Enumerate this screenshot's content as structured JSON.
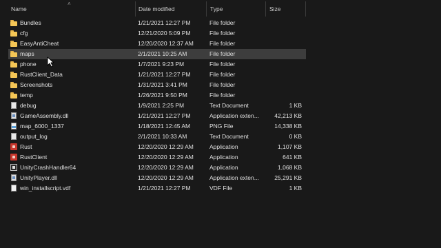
{
  "columns": {
    "name": "Name",
    "date": "Date modified",
    "type": "Type",
    "size": "Size"
  },
  "files": [
    {
      "name": "Bundles",
      "date": "1/21/2021 12:27 PM",
      "type": "File folder",
      "size": "",
      "icon": "folder-icon"
    },
    {
      "name": "cfg",
      "date": "12/21/2020 5:09 PM",
      "type": "File folder",
      "size": "",
      "icon": "folder-icon"
    },
    {
      "name": "EasyAntiCheat",
      "date": "12/20/2020 12:37 AM",
      "type": "File folder",
      "size": "",
      "icon": "folder-icon"
    },
    {
      "name": "maps",
      "date": "2/1/2021 10:25 AM",
      "type": "File folder",
      "size": "",
      "icon": "folder-icon",
      "selected": true
    },
    {
      "name": "phone",
      "date": "1/7/2021 9:23 PM",
      "type": "File folder",
      "size": "",
      "icon": "folder-icon"
    },
    {
      "name": "RustClient_Data",
      "date": "1/21/2021 12:27 PM",
      "type": "File folder",
      "size": "",
      "icon": "folder-icon"
    },
    {
      "name": "Screenshots",
      "date": "1/31/2021 3:41 PM",
      "type": "File folder",
      "size": "",
      "icon": "folder-icon"
    },
    {
      "name": "temp",
      "date": "1/26/2021 9:50 PM",
      "type": "File folder",
      "size": "",
      "icon": "folder-icon"
    },
    {
      "name": "debug",
      "date": "1/9/2021 2:25 PM",
      "type": "Text Document",
      "size": "1 KB",
      "icon": "text-file-icon"
    },
    {
      "name": "GameAssembly.dll",
      "date": "1/21/2021 12:27 PM",
      "type": "Application exten...",
      "size": "42,213 KB",
      "icon": "dll-file-icon"
    },
    {
      "name": "map_6000_1337",
      "date": "1/18/2021 12:45 AM",
      "type": "PNG File",
      "size": "14,338 KB",
      "icon": "png-file-icon"
    },
    {
      "name": "output_log",
      "date": "2/1/2021 10:33 AM",
      "type": "Text Document",
      "size": "0 KB",
      "icon": "text-file-icon"
    },
    {
      "name": "Rust",
      "date": "12/20/2020 12:29 AM",
      "type": "Application",
      "size": "1,107 KB",
      "icon": "rust-app-icon"
    },
    {
      "name": "RustClient",
      "date": "12/20/2020 12:29 AM",
      "type": "Application",
      "size": "641 KB",
      "icon": "rust-app-icon"
    },
    {
      "name": "UnityCrashHandler64",
      "date": "12/20/2020 12:29 AM",
      "type": "Application",
      "size": "1,068 KB",
      "icon": "unity-app-icon"
    },
    {
      "name": "UnityPlayer.dll",
      "date": "12/20/2020 12:29 AM",
      "type": "Application exten...",
      "size": "25,291 KB",
      "icon": "dll-file-icon"
    },
    {
      "name": "win_installscript.vdf",
      "date": "1/21/2021 12:27 PM",
      "type": "VDF File",
      "size": "1 KB",
      "icon": "vdf-file-icon"
    }
  ],
  "colors": {
    "background": "#191919",
    "selected_row": "#3d3d3d",
    "folder": "#f4c656",
    "rust": "#c8372d"
  }
}
